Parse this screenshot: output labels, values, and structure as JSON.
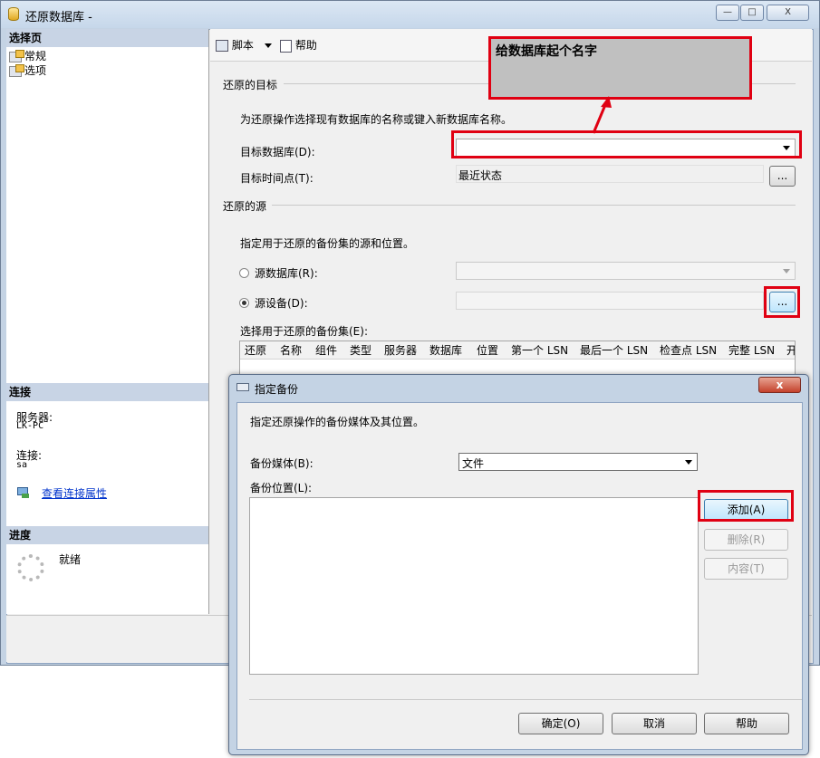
{
  "main": {
    "title": "还原数据库 -",
    "controls": {
      "minimize": "—",
      "maximize": "□",
      "close": "X"
    }
  },
  "left": {
    "select_page_header": "选择页",
    "nav_items": [
      {
        "label": "常规"
      },
      {
        "label": "选项"
      }
    ],
    "connection_header": "连接",
    "server_label": "服务器:",
    "server_value": "LK-PC",
    "connection_label": "连接:",
    "connection_value": "sa",
    "view_connection_link": "查看连接属性",
    "progress_header": "进度",
    "progress_status": "就绪"
  },
  "toolbar": {
    "script_label": "脚本",
    "help_label": "帮助"
  },
  "restore_target": {
    "section_title": "还原的目标",
    "description": "为还原操作选择现有数据库的名称或键入新数据库名称。",
    "target_db_label": "目标数据库(D):",
    "target_db_value": "",
    "target_time_label": "目标时间点(T):",
    "target_time_value": "最近状态",
    "browse_label": "..."
  },
  "annotation": {
    "text": "给数据库起个名字"
  },
  "restore_source": {
    "section_title": "还原的源",
    "description": "指定用于还原的备份集的源和位置。",
    "source_db_label": "源数据库(R):",
    "source_device_label": "源设备(D):",
    "browse_label": "...",
    "backup_set_label": "选择用于还原的备份集(E):",
    "columns": [
      "还原",
      "名称",
      "组件",
      "类型",
      "服务器",
      "数据库",
      "位置",
      "第一个 LSN",
      "最后一个 LSN",
      "检查点 LSN",
      "完整 LSN",
      "开"
    ]
  },
  "dialog": {
    "title": "指定备份",
    "close": "x",
    "description": "指定还原操作的备份媒体及其位置。",
    "media_label": "备份媒体(B):",
    "media_value": "文件",
    "location_label": "备份位置(L):",
    "add_label": "添加(A)",
    "remove_label": "删除(R)",
    "contents_label": "内容(T)",
    "ok_label": "确定(O)",
    "cancel_label": "取消",
    "help_label": "帮助"
  }
}
